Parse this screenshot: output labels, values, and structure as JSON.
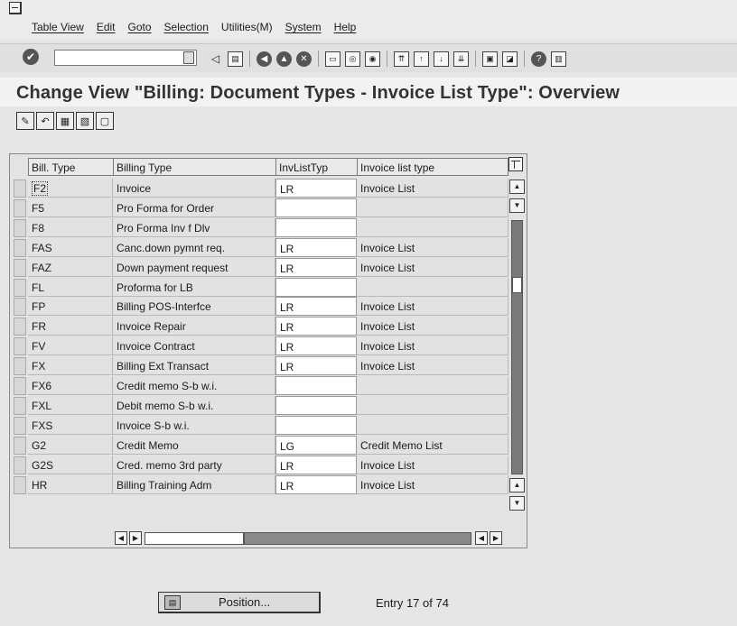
{
  "menu": {
    "items": [
      "Table View",
      "Edit",
      "Goto",
      "Selection",
      "Utilities(M)",
      "System",
      "Help"
    ]
  },
  "toolbar": {
    "command_field_value": "",
    "icons": [
      "enter-icon",
      "history-dropdown-icon",
      "back-arrow-icon",
      "save-icon",
      "back-icon",
      "exit-icon",
      "cancel-icon",
      "print-icon",
      "find-icon",
      "find-next-icon",
      "first-page-icon",
      "previous-page-icon",
      "next-page-icon",
      "last-page-icon",
      "new-session-icon",
      "shortcut-icon",
      "help-icon",
      "layout-menu-icon"
    ]
  },
  "page": {
    "title": "Change View \"Billing: Document Types - Invoice List Type\": Overview"
  },
  "app_toolbar": {
    "icons": [
      "display-change-icon",
      "undo-change-icon",
      "select-all-icon",
      "select-block-icon",
      "deselect-all-icon"
    ]
  },
  "table": {
    "columns": [
      "Bill. Type",
      "Billing Type",
      "InvListTyp",
      "Invoice list type"
    ],
    "rows": [
      [
        "F2",
        "Invoice",
        "LR",
        "Invoice List"
      ],
      [
        "F5",
        "Pro Forma for Order",
        "",
        ""
      ],
      [
        "F8",
        "Pro Forma Inv f Dlv",
        "",
        ""
      ],
      [
        "FAS",
        "Canc.down pymnt req.",
        "LR",
        "Invoice List"
      ],
      [
        "FAZ",
        "Down payment request",
        "LR",
        "Invoice List"
      ],
      [
        "FL",
        "Proforma for LB",
        "",
        ""
      ],
      [
        "FP",
        "Billing POS-Interfce",
        "LR",
        "Invoice List"
      ],
      [
        "FR",
        "Invoice Repair",
        "LR",
        "Invoice List"
      ],
      [
        "FV",
        "Invoice Contract",
        "LR",
        "Invoice List"
      ],
      [
        "FX",
        "Billing Ext Transact",
        "LR",
        "Invoice List"
      ],
      [
        "FX6",
        "Credit memo S-b w.i.",
        "",
        ""
      ],
      [
        "FXL",
        "Debit memo S-b w.i.",
        "",
        ""
      ],
      [
        "FXS",
        "Invoice S-b w.i.",
        "",
        ""
      ],
      [
        "G2",
        "Credit Memo",
        "LG",
        "Credit Memo List"
      ],
      [
        "G2S",
        "Cred. memo 3rd party",
        "LR",
        "Invoice List"
      ],
      [
        "HR",
        "Billing Training Adm",
        "LR",
        "Invoice List"
      ]
    ]
  },
  "footer": {
    "position_button": "Position...",
    "entry_text": "Entry 17 of 74"
  }
}
